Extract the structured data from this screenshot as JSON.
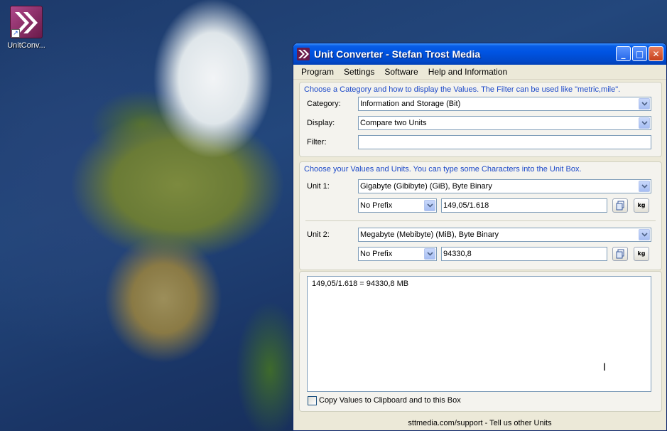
{
  "desktop": {
    "icon_label": "UnitConv..."
  },
  "window": {
    "title": "Unit Converter - Stefan Trost Media",
    "controls": {
      "minimize": "_",
      "maximize": "□",
      "close": "✕"
    }
  },
  "menu": [
    "Program",
    "Settings",
    "Software",
    "Help and Information"
  ],
  "category_group": {
    "caption": "Choose a Category and how to display the Values. The Filter can be used like \"metric,mile\".",
    "category_label": "Category:",
    "category_value": "Information and Storage (Bit)",
    "display_label": "Display:",
    "display_value": "Compare two Units",
    "filter_label": "Filter:",
    "filter_value": ""
  },
  "values_group": {
    "caption": "Choose your Values and Units. You can type some Characters into the Unit Box.",
    "unit1": {
      "label": "Unit 1:",
      "unit": "Gigabyte (Gibibyte) (GiB), Byte Binary",
      "prefix": "No Prefix",
      "value": "149,05/1.618"
    },
    "unit2": {
      "label": "Unit 2:",
      "unit": "Megabyte (Mebibyte) (MiB), Byte Binary",
      "prefix": "No Prefix",
      "value": "94330,8"
    },
    "kg_label": "kg"
  },
  "output": {
    "text": "149,05/1.618 = 94330,8 MB",
    "copy_checkbox_label": "Copy Values to Clipboard and to this Box",
    "copy_checked": false
  },
  "footer": "sttmedia.com/support - Tell us other Units",
  "colors": {
    "accent": "#1c49c8",
    "titlebar": "#0054e3",
    "window_bg": "#ece9d8"
  }
}
